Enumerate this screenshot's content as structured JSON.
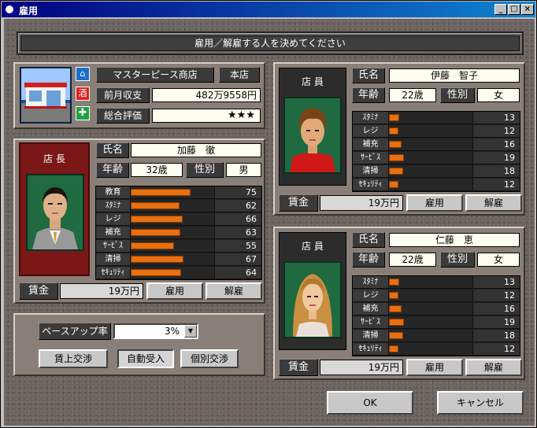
{
  "window": {
    "title": "雇用"
  },
  "banner": {
    "text": "雇用／解雇する人を決めてください"
  },
  "shop": {
    "name": "マスターピース商店",
    "branch": "本店",
    "revenue_label": "前月収支",
    "revenue_value": "482万9558円",
    "rating_label": "総合評価",
    "rating_value": "★★★"
  },
  "manager": {
    "role": "店 長",
    "name_label": "氏名",
    "name": "加藤　徹",
    "age_label": "年齢",
    "age": "32歳",
    "gender_label": "性別",
    "gender": "男",
    "stats": [
      {
        "label": "教育",
        "value": "75",
        "pct": 75
      },
      {
        "label": "ｽﾀﾐﾅ",
        "value": "62",
        "pct": 62
      },
      {
        "label": "レジ",
        "value": "66",
        "pct": 66
      },
      {
        "label": "補充",
        "value": "63",
        "pct": 63
      },
      {
        "label": "ｻｰﾋﾞｽ",
        "value": "55",
        "pct": 55
      },
      {
        "label": "清掃",
        "value": "67",
        "pct": 67
      },
      {
        "label": "ｾｷｭﾘﾃｨ",
        "value": "64",
        "pct": 64
      }
    ],
    "wage_label": "賃金",
    "wage": "19万円",
    "hire": "雇用",
    "fire": "解雇"
  },
  "staff": [
    {
      "role": "店 員",
      "name_label": "氏名",
      "name": "伊藤　智子",
      "age_label": "年齢",
      "age": "22歳",
      "gender_label": "性別",
      "gender": "女",
      "stats": [
        {
          "label": "ｽﾀﾐﾅ",
          "value": "13",
          "pct": 13
        },
        {
          "label": "レジ",
          "value": "12",
          "pct": 12
        },
        {
          "label": "補充",
          "value": "16",
          "pct": 16
        },
        {
          "label": "ｻｰﾋﾞｽ",
          "value": "19",
          "pct": 19
        },
        {
          "label": "清掃",
          "value": "18",
          "pct": 18
        },
        {
          "label": "ｾｷｭﾘﾃｨ",
          "value": "12",
          "pct": 12
        }
      ],
      "wage_label": "賃金",
      "wage": "19万円",
      "hire": "雇用",
      "fire": "解雇"
    },
    {
      "role": "店 員",
      "name_label": "氏名",
      "name": "仁藤　恵",
      "age_label": "年齢",
      "age": "22歳",
      "gender_label": "性別",
      "gender": "女",
      "stats": [
        {
          "label": "ｽﾀﾐﾅ",
          "value": "13",
          "pct": 13
        },
        {
          "label": "レジ",
          "value": "12",
          "pct": 12
        },
        {
          "label": "補充",
          "value": "16",
          "pct": 16
        },
        {
          "label": "ｻｰﾋﾞｽ",
          "value": "19",
          "pct": 19
        },
        {
          "label": "清掃",
          "value": "18",
          "pct": 18
        },
        {
          "label": "ｾｷｭﾘﾃｨ",
          "value": "12",
          "pct": 12
        }
      ],
      "wage_label": "賃金",
      "wage": "19万円",
      "hire": "雇用",
      "fire": "解雇"
    }
  ],
  "salary": {
    "baseup_label": "ベースアップ率",
    "baseup_value": "3%",
    "negotiate": "賃上交渉",
    "auto_accept": "自動受入",
    "individual": "個別交渉"
  },
  "footer": {
    "ok": "OK",
    "cancel": "キャンセル"
  }
}
